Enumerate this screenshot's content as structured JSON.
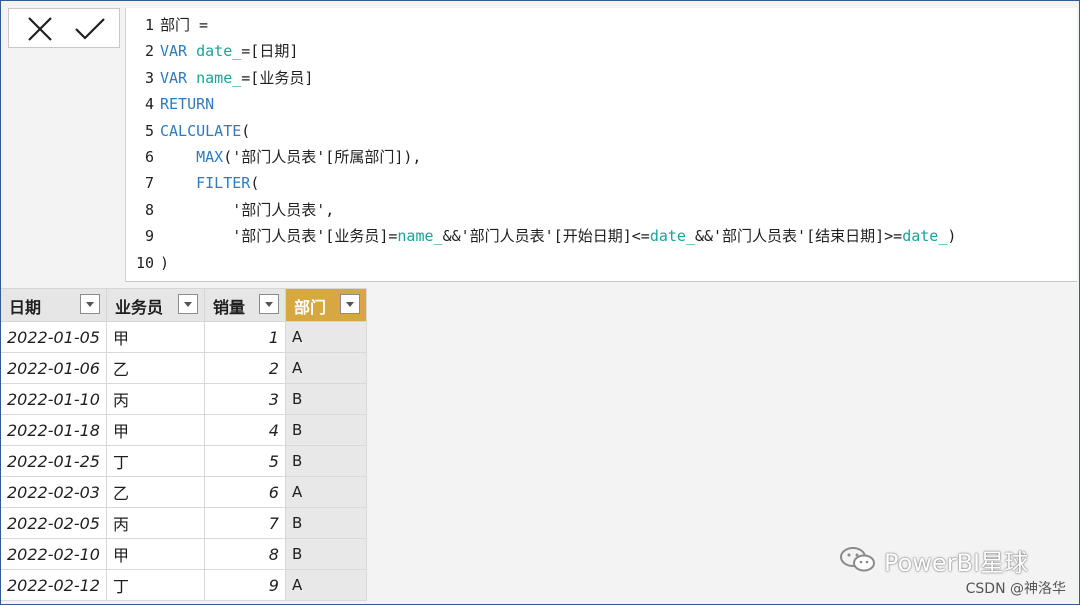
{
  "formula_bar": {
    "cancel_icon": "x-icon",
    "commit_icon": "check-icon",
    "lines": [
      {
        "n": "1",
        "parts": [
          {
            "t": "txt",
            "v": "部门 ="
          }
        ]
      },
      {
        "n": "2",
        "parts": [
          {
            "t": "k",
            "v": "VAR "
          },
          {
            "t": "v",
            "v": "date_"
          },
          {
            "t": "txt",
            "v": "=[日期]"
          }
        ]
      },
      {
        "n": "3",
        "parts": [
          {
            "t": "k",
            "v": "VAR "
          },
          {
            "t": "v",
            "v": "name_"
          },
          {
            "t": "txt",
            "v": "=[业务员]"
          }
        ]
      },
      {
        "n": "4",
        "parts": [
          {
            "t": "k",
            "v": "RETURN"
          }
        ]
      },
      {
        "n": "5",
        "parts": [
          {
            "t": "k",
            "v": "CALCULATE"
          },
          {
            "t": "txt",
            "v": "("
          }
        ]
      },
      {
        "n": "6",
        "parts": [
          {
            "t": "txt",
            "v": "    "
          },
          {
            "t": "k",
            "v": "MAX"
          },
          {
            "t": "txt",
            "v": "('部门人员表'[所属部门]),"
          }
        ]
      },
      {
        "n": "7",
        "parts": [
          {
            "t": "txt",
            "v": "    "
          },
          {
            "t": "k",
            "v": "FILTER"
          },
          {
            "t": "txt",
            "v": "("
          }
        ]
      },
      {
        "n": "8",
        "parts": [
          {
            "t": "txt",
            "v": "        '部门人员表',"
          }
        ]
      },
      {
        "n": "9",
        "parts": [
          {
            "t": "txt",
            "v": "        '部门人员表'[业务员]="
          },
          {
            "t": "v",
            "v": "name_"
          },
          {
            "t": "txt",
            "v": "&&'部门人员表'[开始日期]<="
          },
          {
            "t": "v",
            "v": "date_"
          },
          {
            "t": "txt",
            "v": "&&'部门人员表'[结束日期]>="
          },
          {
            "t": "v",
            "v": "date_"
          },
          {
            "t": "txt",
            "v": ")"
          }
        ]
      },
      {
        "n": "10",
        "parts": [
          {
            "t": "txt",
            "v": ")"
          }
        ]
      }
    ]
  },
  "table": {
    "columns": [
      "日期",
      "业务员",
      "销量",
      "部门"
    ],
    "highlight_color": "#d7a742",
    "rows": [
      [
        "2022-01-05",
        "甲",
        "1",
        "A"
      ],
      [
        "2022-01-06",
        "乙",
        "2",
        "A"
      ],
      [
        "2022-01-10",
        "丙",
        "3",
        "B"
      ],
      [
        "2022-01-18",
        "甲",
        "4",
        "B"
      ],
      [
        "2022-01-25",
        "丁",
        "5",
        "B"
      ],
      [
        "2022-02-03",
        "乙",
        "6",
        "A"
      ],
      [
        "2022-02-05",
        "丙",
        "7",
        "B"
      ],
      [
        "2022-02-10",
        "甲",
        "8",
        "B"
      ],
      [
        "2022-02-12",
        "丁",
        "9",
        "A"
      ]
    ]
  },
  "watermark": {
    "brand": "PowerBI星球",
    "credit": "CSDN @神洛华",
    "icon": "wechat-icon"
  }
}
